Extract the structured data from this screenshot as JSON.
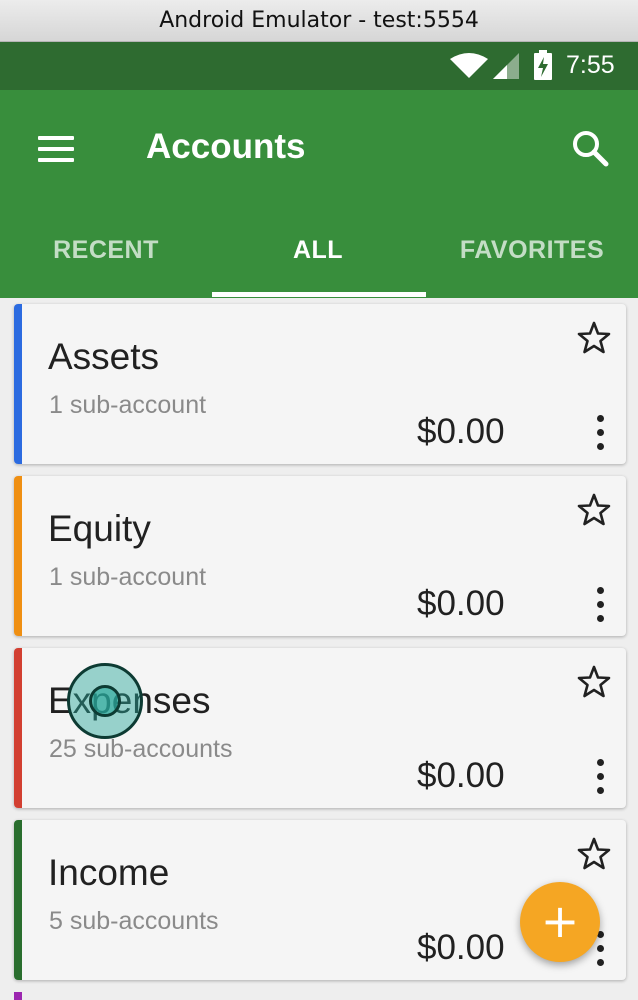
{
  "window": {
    "title": "Android Emulator - test:5554"
  },
  "status_bar": {
    "time": "7:55",
    "icons": [
      "wifi-icon",
      "signal-icon",
      "battery-charging-icon"
    ]
  },
  "app_bar": {
    "title": "Accounts",
    "menu_icon": "menu-icon",
    "search_icon": "search-icon"
  },
  "tabs": [
    {
      "label": "RECENT",
      "selected": false
    },
    {
      "label": "ALL",
      "selected": true
    },
    {
      "label": "FAVORITES",
      "selected": false
    }
  ],
  "accounts": [
    {
      "name": "Assets",
      "sub": "1 sub-account",
      "balance": "$0.00",
      "color": "#2c6be0",
      "favorite": false
    },
    {
      "name": "Equity",
      "sub": "1 sub-account",
      "balance": "$0.00",
      "color": "#ef8f12",
      "favorite": false
    },
    {
      "name": "Expenses",
      "sub": "25 sub-accounts",
      "balance": "$0.00",
      "color": "#d23f31",
      "favorite": false
    },
    {
      "name": "Income",
      "sub": "5 sub-accounts",
      "balance": "$0.00",
      "color": "#2a6e2e",
      "favorite": false
    }
  ],
  "fab": {
    "label": "+",
    "icon": "add-icon",
    "color": "#f5a623"
  },
  "colors": {
    "primary": "#388e3c",
    "primary_dark": "#2e6b30",
    "next_account_stripe": "#9c27b0"
  }
}
